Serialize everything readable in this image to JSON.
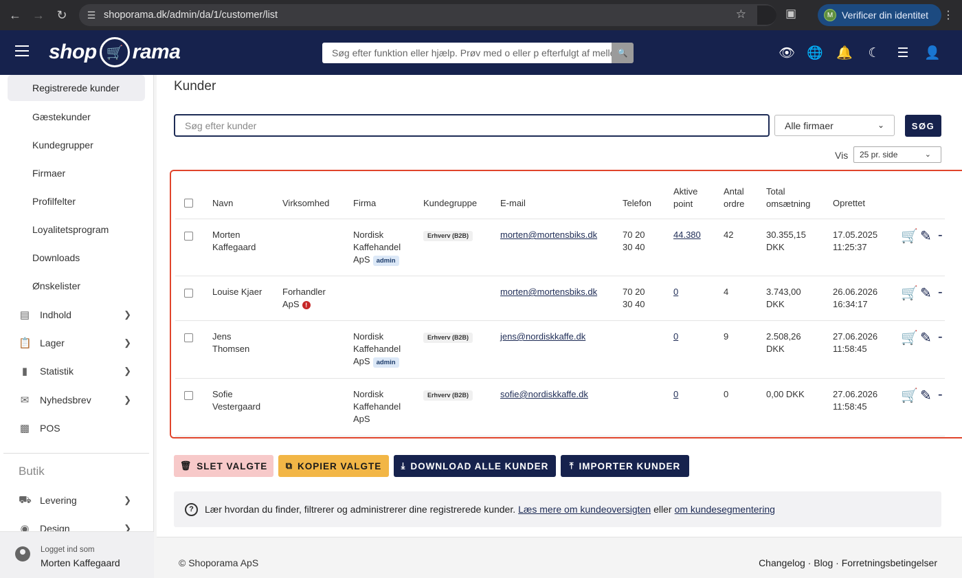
{
  "browser": {
    "url": "shoporama.dk/admin/da/1/customer/list",
    "verify_label": "Verificer din identitet",
    "verify_avatar": "M"
  },
  "header": {
    "logo_left": "shop",
    "logo_right": "rama",
    "search_placeholder": "Søg efter funktion eller hjælp. Prøv med o eller p efterfulgt af mellemrum"
  },
  "sidebar": {
    "sub_items": [
      {
        "label": "Registrerede kunder",
        "active": true
      },
      {
        "label": "Gæstekunder"
      },
      {
        "label": "Kundegrupper"
      },
      {
        "label": "Firmaer"
      },
      {
        "label": "Profilfelter"
      },
      {
        "label": "Loyalitetsprogram"
      },
      {
        "label": "Downloads"
      },
      {
        "label": "Ønskelister"
      }
    ],
    "groups": [
      {
        "label": "Indhold",
        "icon": "document-icon"
      },
      {
        "label": "Lager",
        "icon": "clipboard-icon"
      },
      {
        "label": "Statistik",
        "icon": "bar-chart-icon"
      },
      {
        "label": "Nyhedsbrev",
        "icon": "mail-icon"
      },
      {
        "label": "POS",
        "icon": "register-icon"
      }
    ],
    "section_title": "Butik",
    "butik_groups": [
      {
        "label": "Levering",
        "icon": "truck-icon"
      },
      {
        "label": "Design",
        "icon": "palette-icon"
      }
    ],
    "logged_in_label": "Logget ind som",
    "user_name": "Morten Kaffegaard"
  },
  "main": {
    "title": "Kunder",
    "search_placeholder": "Søg efter kunder",
    "firm_select": "Alle firmaer",
    "search_button": "SØG",
    "vis_label": "Vis",
    "per_page": "25 pr. side",
    "columns": {
      "navn": "Navn",
      "virksomhed": "Virksomhed",
      "firma": "Firma",
      "kundegruppe": "Kundegruppe",
      "email": "E-mail",
      "telefon": "Telefon",
      "aktive_point": "Aktive point",
      "antal_ordre": "Antal ordre",
      "total": "Total omsætning",
      "oprettet": "Oprettet"
    },
    "rows": [
      {
        "navn": "Morten Kaffegaard",
        "virksomhed": "",
        "firma": "Nordisk Kaffehandel ApS",
        "admin": "admin",
        "gruppe": "Erhverv (B2B)",
        "email": "morten@mortensbiks.dk",
        "telefon": "70 20 30 40",
        "point": "44.380",
        "ordre": "42",
        "total": "30.355,15 DKK",
        "oprettet": "17.05.2025 11:25:37"
      },
      {
        "navn": "Louise Kjaer",
        "virksomhed": "Forhandler ApS",
        "firma": "",
        "admin": "",
        "gruppe": "",
        "email": "morten@mortensbiks.dk",
        "telefon": "70 20 30 40",
        "point": "0",
        "ordre": "4",
        "total": "3.743,00 DKK",
        "oprettet": "26.06.2026 16:34:17"
      },
      {
        "navn": "Jens Thomsen",
        "virksomhed": "",
        "firma": "Nordisk Kaffehandel ApS",
        "admin": "admin",
        "gruppe": "Erhverv (B2B)",
        "email": "jens@nordiskkaffe.dk",
        "telefon": "",
        "point": "0",
        "ordre": "9",
        "total": "2.508,26 DKK",
        "oprettet": "27.06.2026 11:58:45"
      },
      {
        "navn": "Sofie Vestergaard",
        "virksomhed": "",
        "firma": "Nordisk Kaffehandel ApS",
        "admin": "",
        "gruppe": "Erhverv (B2B)",
        "email": "sofie@nordiskkaffe.dk",
        "telefon": "",
        "point": "0",
        "ordre": "0",
        "total": "0,00 DKK",
        "oprettet": "27.06.2026 11:58:45"
      }
    ],
    "buttons": {
      "delete": "SLET VALGTE",
      "copy": "KOPIER VALGTE",
      "download": "DOWNLOAD ALLE KUNDER",
      "import": "IMPORTER KUNDER"
    },
    "help": {
      "text": "Lær hvordan du finder, filtrerer og administrerer dine registrerede kunder.",
      "link1": "Læs mere om kundeoversigten",
      "connector": "eller",
      "link2": "om kundesegmentering"
    }
  },
  "footer": {
    "copyright": "© Shoporama ApS",
    "links": "Changelog · Blog · Forretningsbetingelser"
  },
  "colors": {
    "brand_navy": "#16224d",
    "highlight_red": "#e0442b",
    "copy_yellow": "#f2b646",
    "delete_pink": "#f7c9c9"
  }
}
